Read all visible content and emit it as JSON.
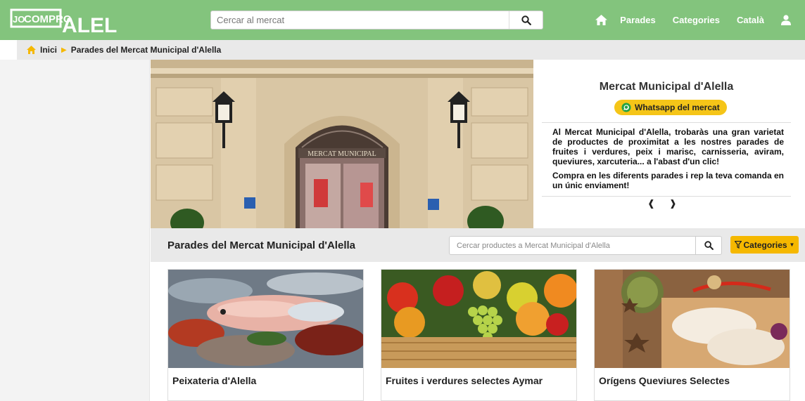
{
  "header": {
    "logo_text": "Jo COMPRO A ALELLA",
    "search_placeholder": "Cercar al mercat",
    "nav": {
      "parades": "Parades",
      "categories": "Categories",
      "language": "Català"
    }
  },
  "breadcrumb": {
    "home": "Inici",
    "current": "Parades del Mercat Municipal d'Alella"
  },
  "hero": {
    "sign_text": "MERCAT MUNICIPAL"
  },
  "info": {
    "title": "Mercat Municipal d'Alella",
    "whatsapp_label": "Whatsapp del mercat",
    "paragraph1": "Al Mercat Municipal d'Alella, trobaràs una gran varietat de productes de proximitat a les nostres parades de fruites i verdures, peix i marisc, carnisseria, aviram, queviures, xarcuteria... a l'abast d'un clic!",
    "paragraph2": "Compra en les diferents parades i rep la teva comanda en un únic enviament!"
  },
  "section": {
    "title": "Parades del Mercat Municipal d'Alella",
    "search_placeholder": "Cercar productes a Mercat Municipal d'Alella",
    "categories_label": "Categories"
  },
  "cards": [
    {
      "name": "Peixateria d'Alella"
    },
    {
      "name": "Fruites i verdures selectes Aymar"
    },
    {
      "name": "Orígens Queviures Selectes"
    }
  ],
  "colors": {
    "header_green": "#83c47d",
    "accent_yellow": "#f5b800",
    "whatsapp_yellow": "#f5c518"
  }
}
